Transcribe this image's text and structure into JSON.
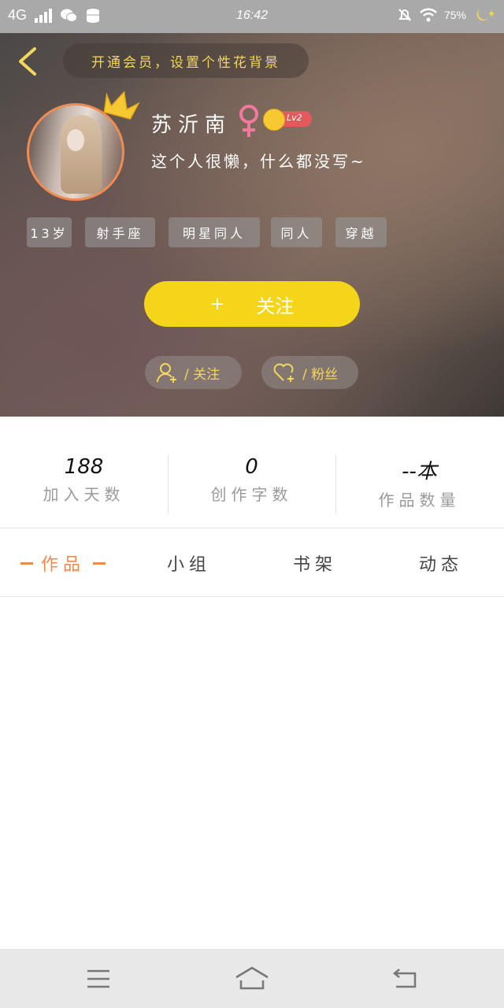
{
  "status_bar": {
    "network": "4G",
    "time": "16:42",
    "battery": "75%"
  },
  "header": {
    "bg_tip": "开通会员，设置个性花背景"
  },
  "profile": {
    "name": "苏沂南",
    "gender_icon": "female-icon",
    "level": "Lv2",
    "bio": "这个人很懒，什么都没写~",
    "tags": [
      "13岁",
      "射手座",
      "明星同人",
      "同人",
      "穿越"
    ]
  },
  "actions": {
    "follow_label": "关注",
    "follow_plus": "+",
    "following_count_label": "/ 关注",
    "fans_count_label": "/ 粉丝"
  },
  "stats": [
    {
      "value": "188",
      "label": "加入天数"
    },
    {
      "value": "0",
      "label": "创作字数"
    },
    {
      "value": "--本",
      "label": "作品数量"
    }
  ],
  "tabs": [
    {
      "label": "作品",
      "active": true
    },
    {
      "label": "小组",
      "active": false
    },
    {
      "label": "书架",
      "active": false
    },
    {
      "label": "动态",
      "active": false
    }
  ],
  "colors": {
    "accent_orange": "#ee8a4a",
    "follow_yellow": "#f5d51a",
    "tip_yellow": "#f2d75a",
    "level_red": "#e15b5b"
  }
}
